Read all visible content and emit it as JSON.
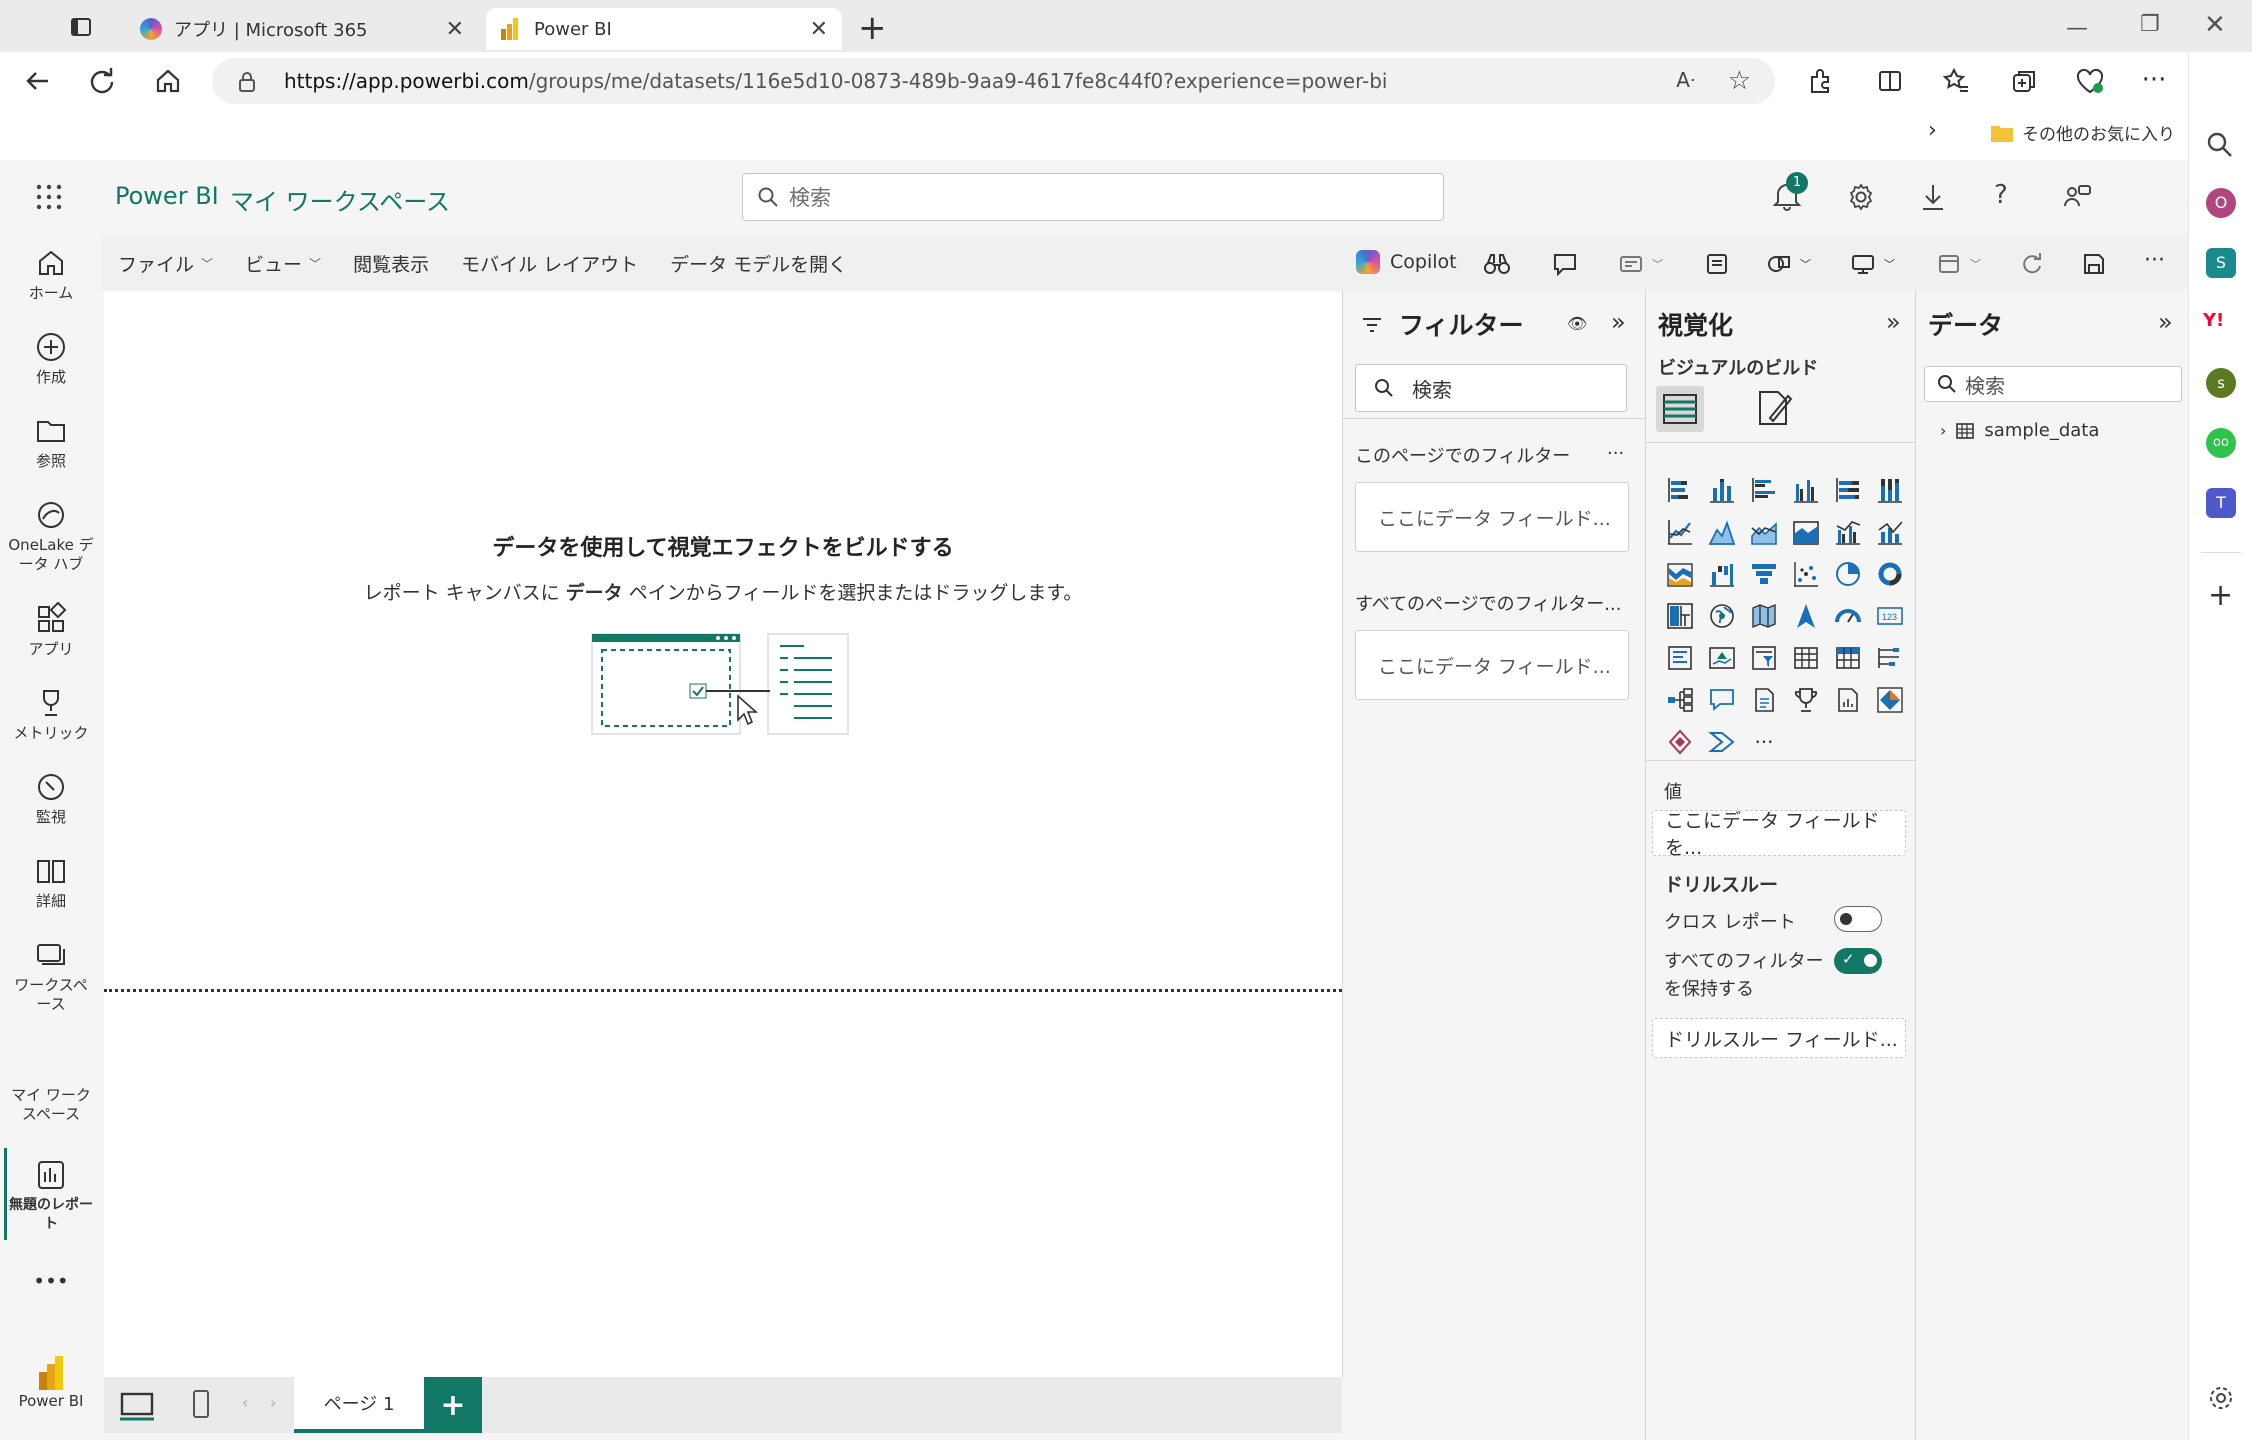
{
  "browser": {
    "tabs": [
      {
        "title": "アプリ | Microsoft 365",
        "close": "✕"
      },
      {
        "title": "Power BI",
        "close": "✕"
      }
    ],
    "new_tab": "+",
    "url_host": "https://app.powerbi.com",
    "url_path": "/groups/me/datasets/116e5d10-0873-489b-9aa9-4617fe8c44f0?experience=power-bi",
    "favorites_folder": "その他のお気に入り"
  },
  "header": {
    "brand": "Power BI",
    "workspace": "マイ ワークスペース",
    "search_placeholder": "検索",
    "notification_count": "1"
  },
  "leftnav": [
    {
      "label": "ホーム",
      "icon": "home-icon"
    },
    {
      "label": "作成",
      "icon": "create-icon"
    },
    {
      "label": "参照",
      "icon": "browse-icon"
    },
    {
      "label": "OneLake データ ハブ",
      "icon": "onelake-icon"
    },
    {
      "label": "アプリ",
      "icon": "apps-icon"
    },
    {
      "label": "メトリック",
      "icon": "metrics-icon"
    },
    {
      "label": "監視",
      "icon": "monitor-icon"
    },
    {
      "label": "詳細",
      "icon": "learn-icon"
    },
    {
      "label": "ワークスペース",
      "icon": "workspaces-icon"
    }
  ],
  "leftnav_extra": {
    "my_workspace": "マイ ワークスペース",
    "untitled_report": "無題のレポート",
    "more": "•••",
    "powerbi": "Power BI"
  },
  "ribbon": {
    "file": "ファイル",
    "view": "ビュー",
    "reading_view": "閲覧表示",
    "mobile_layout": "モバイル レイアウト",
    "open_data_model": "データ モデルを開く",
    "copilot": "Copilot",
    "more": "···"
  },
  "canvas": {
    "heading": "データを使用して視覚エフェクトをビルドする",
    "sub_before": "レポート キャンバスに ",
    "sub_bold": "データ",
    "sub_after": " ペインからフィールドを選択またはドラッグします。"
  },
  "pages": {
    "page1": "ページ 1",
    "add": "+"
  },
  "filters": {
    "title": "フィルター",
    "search_placeholder": "検索",
    "this_page": "このページでのフィルター",
    "all_pages": "すべてのページでのフィルター...",
    "drop_here": "ここにデータ フィールド...",
    "more": "..."
  },
  "visualizations": {
    "title": "視覚化",
    "build_visual": "ビジュアルのビルド",
    "values_label": "値",
    "values_drop": "ここにデータ フィールドを...",
    "drillthrough": "ドリルスルー",
    "cross_report": "クロス レポート",
    "keep_filters_1": "すべてのフィルター",
    "keep_filters_2": "を保持する",
    "drill_drop": "ドリルスルー フィールド...",
    "more_visuals": "···",
    "cross_report_on": false,
    "keep_filters_on": true
  },
  "data": {
    "title": "データ",
    "search_placeholder": "検索",
    "table": "sample_data"
  },
  "colors": {
    "accent": "#117865",
    "brand_text": "#117865",
    "notification": "#117865"
  }
}
